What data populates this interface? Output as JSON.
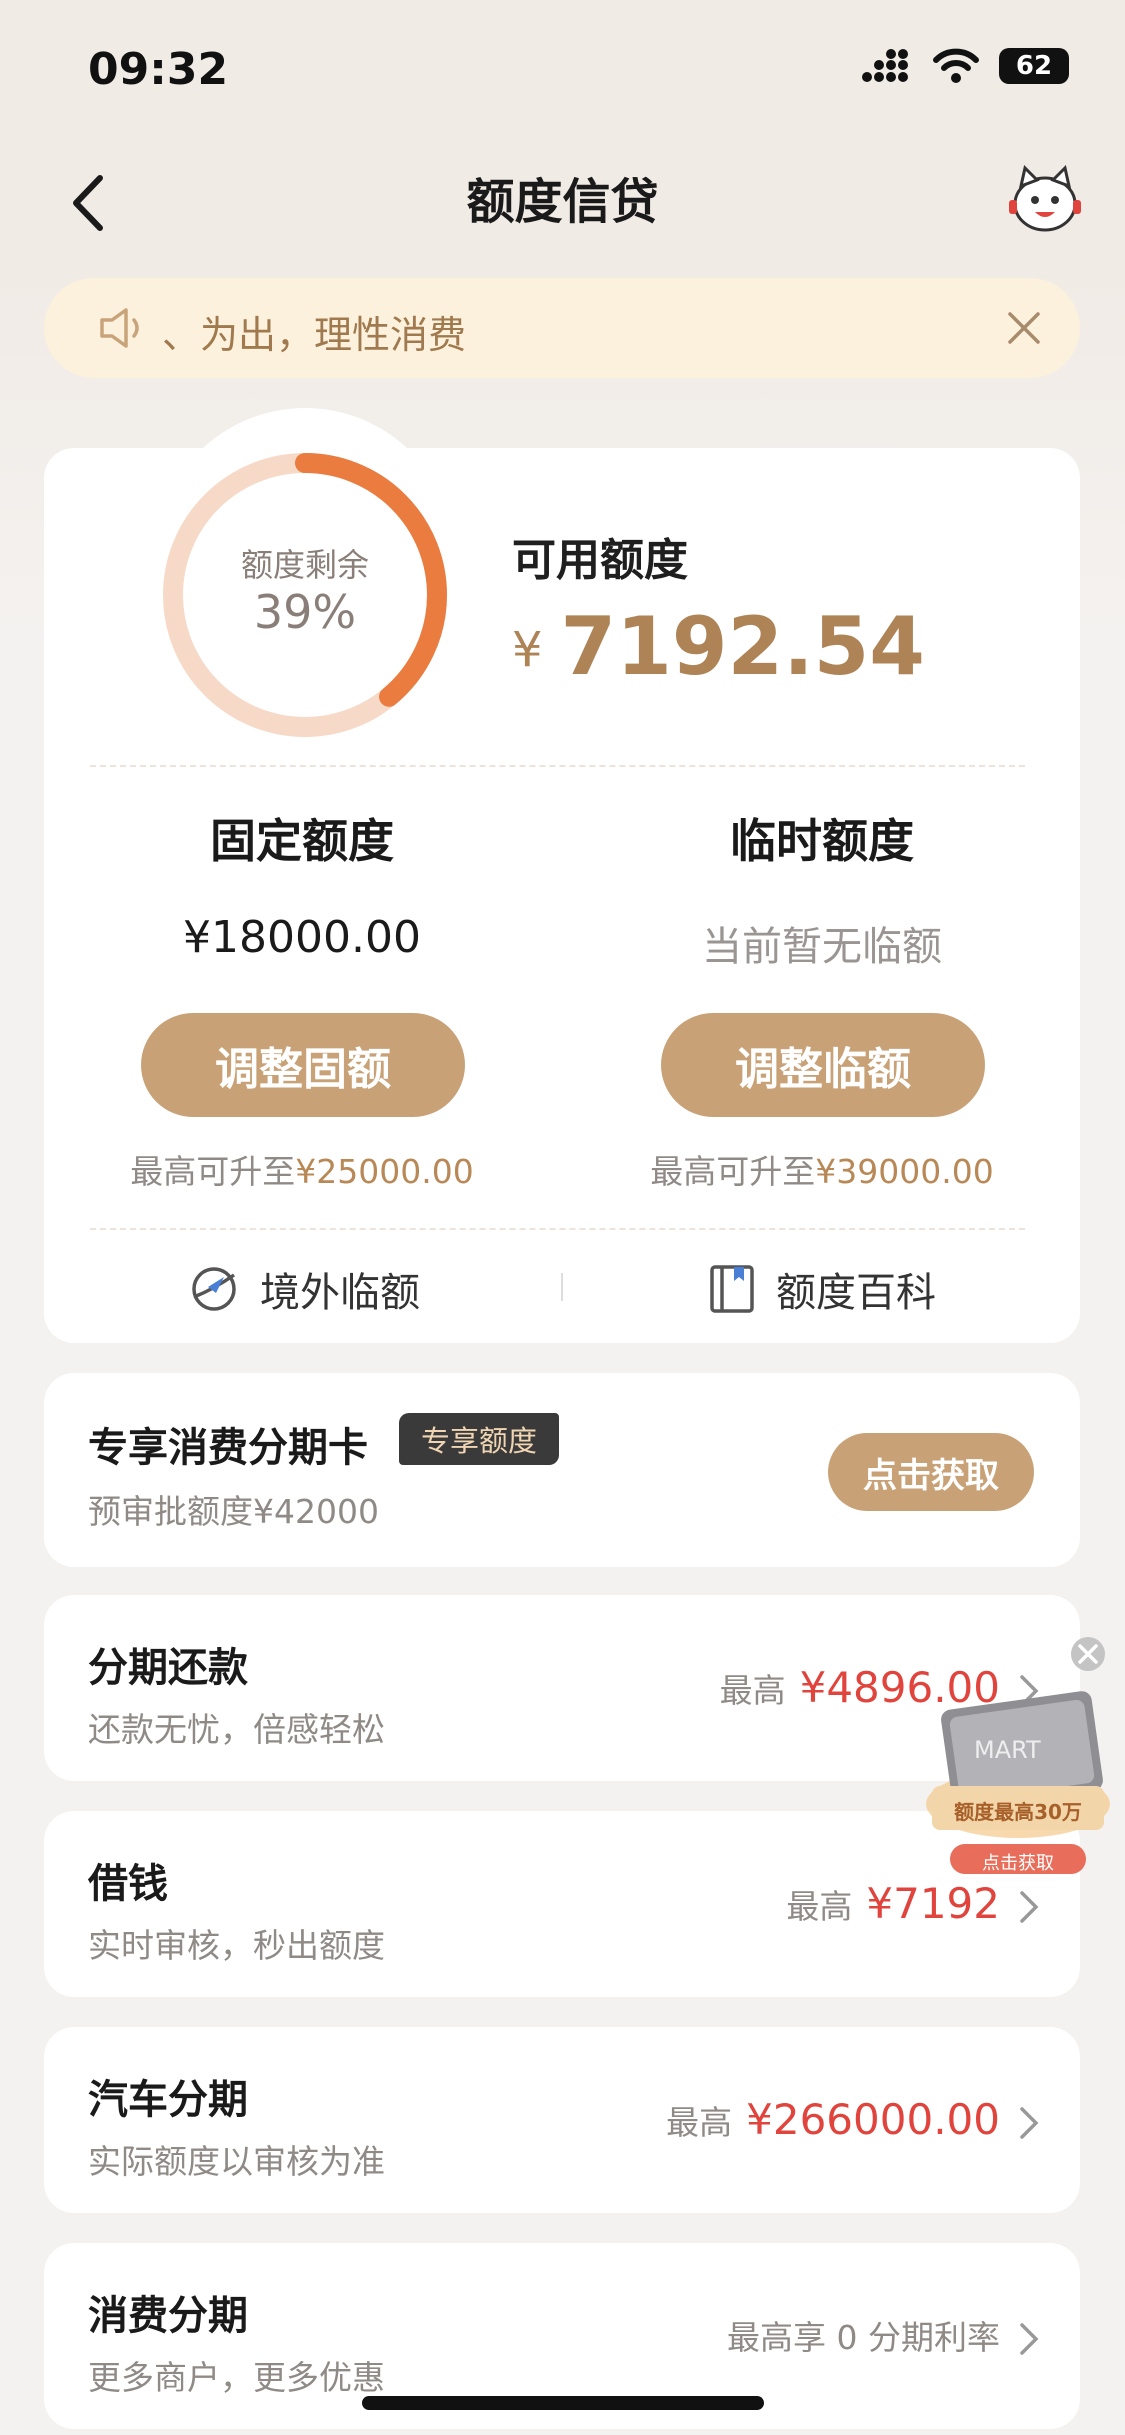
{
  "status_bar": {
    "time": "09:32",
    "battery": "62"
  },
  "header": {
    "title": "额度信贷"
  },
  "notice": {
    "text": "、为出，理性消费"
  },
  "quota": {
    "donut_label": "额度剩余",
    "donut_percent": "39%",
    "remaining_fraction": 0.39,
    "available_label": "可用额度",
    "currency": "¥",
    "available_amount": "7192.54",
    "fixed": {
      "title": "固定额度",
      "value": "¥18000.00",
      "button": "调整固额",
      "note_prefix": "最高可升至",
      "note_amount": "¥25000.00"
    },
    "temp": {
      "title": "临时额度",
      "value": "当前暂无临额",
      "button": "调整临额",
      "note_prefix": "最高可升至",
      "note_amount": "¥39000.00"
    },
    "links": {
      "overseas": "境外临额",
      "encyclopedia": "额度百科"
    }
  },
  "exclusive_card": {
    "title": "专享消费分期卡",
    "badge": "专享额度",
    "subtitle": "预审批额度¥42000",
    "button": "点击获取"
  },
  "products": [
    {
      "title": "分期还款",
      "subtitle": "还款无忧，倍感轻松",
      "prefix": "最高",
      "amount": "¥4896.00"
    },
    {
      "title": "借钱",
      "subtitle": "实时审核，秒出额度",
      "prefix": "最高",
      "amount": "¥7192"
    },
    {
      "title": "汽车分期",
      "subtitle": "实际额度以审核为准",
      "prefix": "最高",
      "amount": "¥266000.00"
    },
    {
      "title": "消费分期",
      "subtitle": "更多商户，更多优惠",
      "prefix": "最高享 0 分期利率",
      "amount": ""
    }
  ],
  "promo": {
    "card_text": "MART",
    "line1": "额度最高30万",
    "button": "点击获取"
  },
  "colors": {
    "gold": "#c8a276",
    "orange": "#ea7c40",
    "red": "#e0443c",
    "donut_track": "#f6d9c6"
  }
}
